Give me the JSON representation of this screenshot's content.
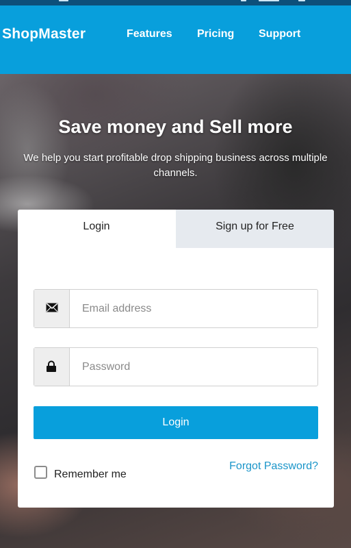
{
  "navbar": {
    "brand": "ShopMaster",
    "links": [
      "Features",
      "Pricing",
      "Support"
    ]
  },
  "hero": {
    "title": "Save money and Sell more",
    "subtitle": "We help you start profitable drop shipping business across multiple channels."
  },
  "auth": {
    "tabs": [
      {
        "label": "Login",
        "active": true
      },
      {
        "label": "Sign up for Free",
        "active": false
      }
    ],
    "email_placeholder": "Email address",
    "email_icon": "envelope-icon",
    "password_placeholder": "Password",
    "password_icon": "lock-icon",
    "login_label": "Login",
    "remember_label": "Remember me",
    "remember_checked": false,
    "forgot_label": "Forgot Password?"
  },
  "colors": {
    "brand_blue": "#089fdc",
    "link_blue": "#1a95c9",
    "inactive_tab": "#e6eaef",
    "status_bar": "#0d4f7a"
  }
}
